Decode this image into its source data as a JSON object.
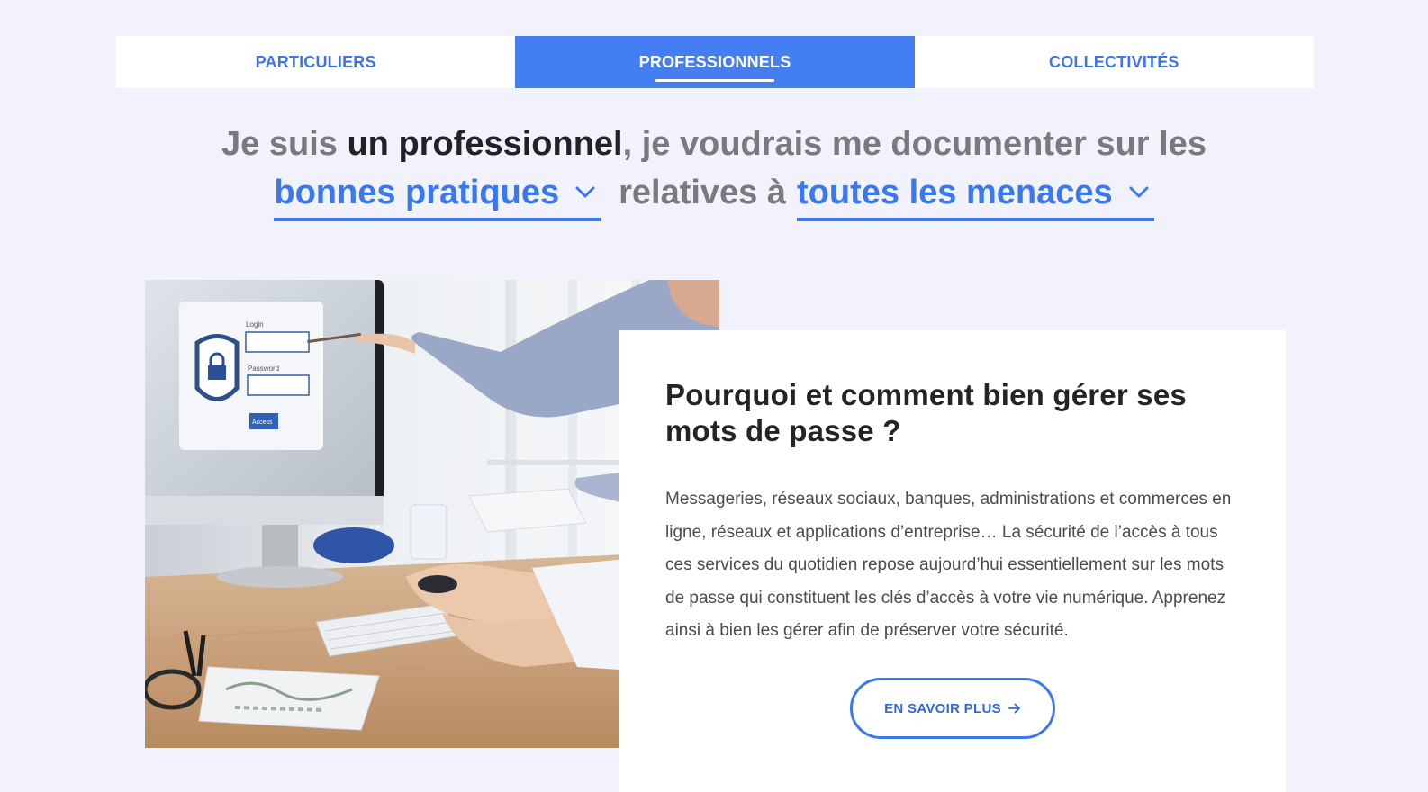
{
  "tabs": [
    {
      "label": "PARTICULIERS",
      "active": false
    },
    {
      "label": "PROFESSIONNELS",
      "active": true
    },
    {
      "label": "COLLECTIVITÉS",
      "active": false
    }
  ],
  "sentence": {
    "prefix": "Je suis ",
    "profile": "un professionnel",
    "middle": ", je voudrais me documenter sur les",
    "topic_select": "bonnes pratiques",
    "relative": "relatives à",
    "threat_select": "toutes les menaces"
  },
  "card": {
    "title": "Pourquoi et comment bien gérer ses mots de passe ?",
    "body": "Messageries, réseaux sociaux, banques, administrations et commerces en ligne, réseaux et applications d’entreprise… La sécurité de l’accès à tous ces services du quotidien repose aujourd’hui essentiellement sur les mots de passe qui constituent les clés d’accès à votre vie numérique. Apprenez ainsi à bien les gérer afin de préserver votre sécurité.",
    "button_label": "EN SAVOIR PLUS"
  },
  "illustration": {
    "login_label": "Login",
    "password_label": "Password",
    "access_label": "Access"
  },
  "colors": {
    "accent": "#437ef3",
    "background": "#f1f2fb",
    "text_dark": "#222226",
    "text_muted": "#7a7a7e"
  },
  "icons": {
    "select_chevron": "chevron-down-icon",
    "button_arrow": "arrow-right-icon"
  }
}
